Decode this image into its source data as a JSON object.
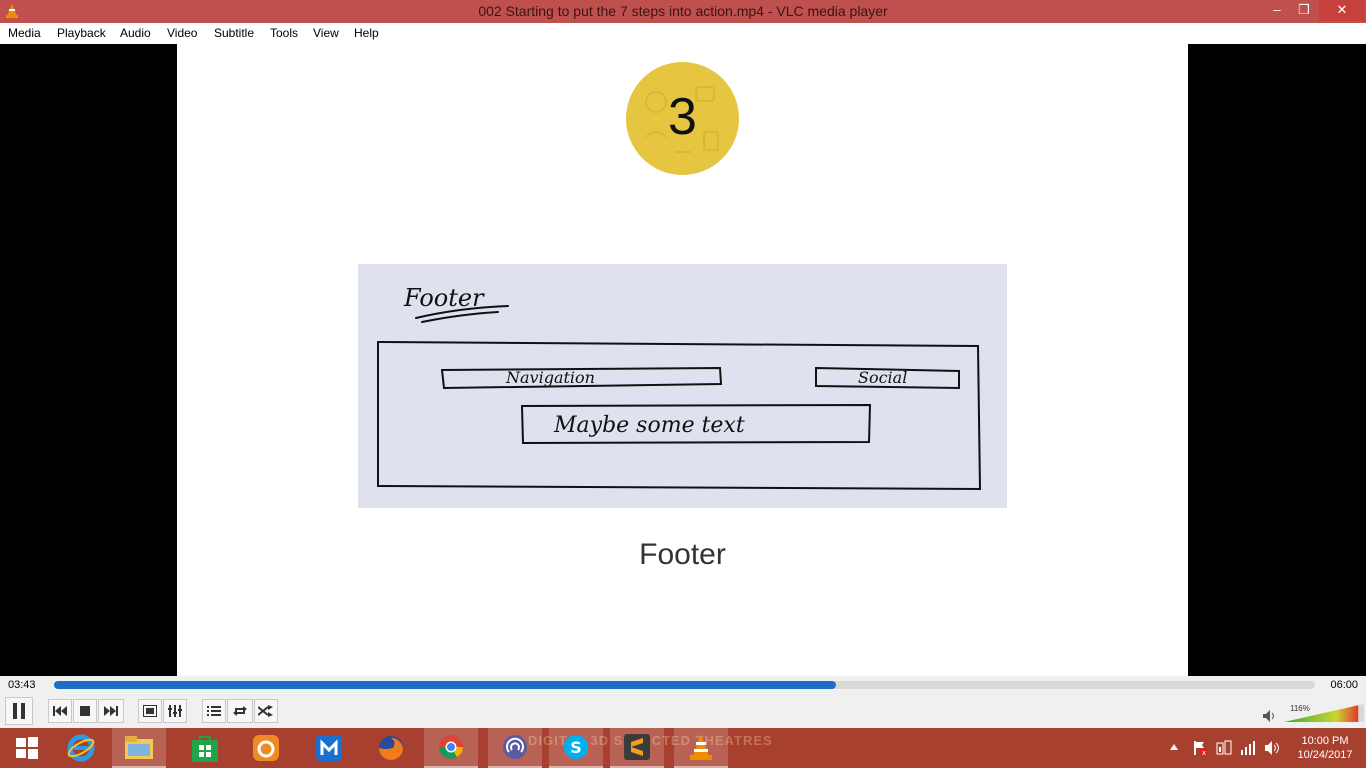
{
  "window": {
    "title": "002 Starting to put the 7 steps into action.mp4 - VLC media player",
    "controls": {
      "minimize": "–",
      "maximize": "❐",
      "close": "✕"
    }
  },
  "menu": [
    "Media",
    "Playback",
    "Audio",
    "Video",
    "Subtitle",
    "Tools",
    "View",
    "Help"
  ],
  "slide": {
    "step_number": "3",
    "caption": "Footer",
    "sketch": {
      "heading": "Footer",
      "navigation": "Navigation",
      "social": "Social",
      "text_box": "Maybe some text"
    }
  },
  "player": {
    "elapsed": "03:43",
    "total": "06:00",
    "progress": 0.62,
    "volume_label": "116%",
    "volume": 1.16
  },
  "controls": [
    "pause-icon",
    "previous-icon",
    "stop-icon",
    "next-icon",
    "fullscreen-icon",
    "extended-settings-icon",
    "playlist-icon",
    "loop-icon",
    "shuffle-icon"
  ],
  "taskbar": {
    "apps": [
      "start",
      "internet-explorer",
      "file-explorer",
      "store",
      "uc-browser",
      "maxthon",
      "firefox",
      "chrome",
      "bittorrent",
      "skype",
      "sublime-text",
      "vlc"
    ],
    "wallpaper_text": "DIGITAL 3D  SELECTED THEATRES",
    "clock_time": "10:00 PM",
    "clock_date": "10/24/2017"
  },
  "colors": {
    "titlebar": "#c0504d",
    "taskbar": "#a8402f",
    "progress": "#1c6fc4",
    "circle": "#e6c540"
  }
}
